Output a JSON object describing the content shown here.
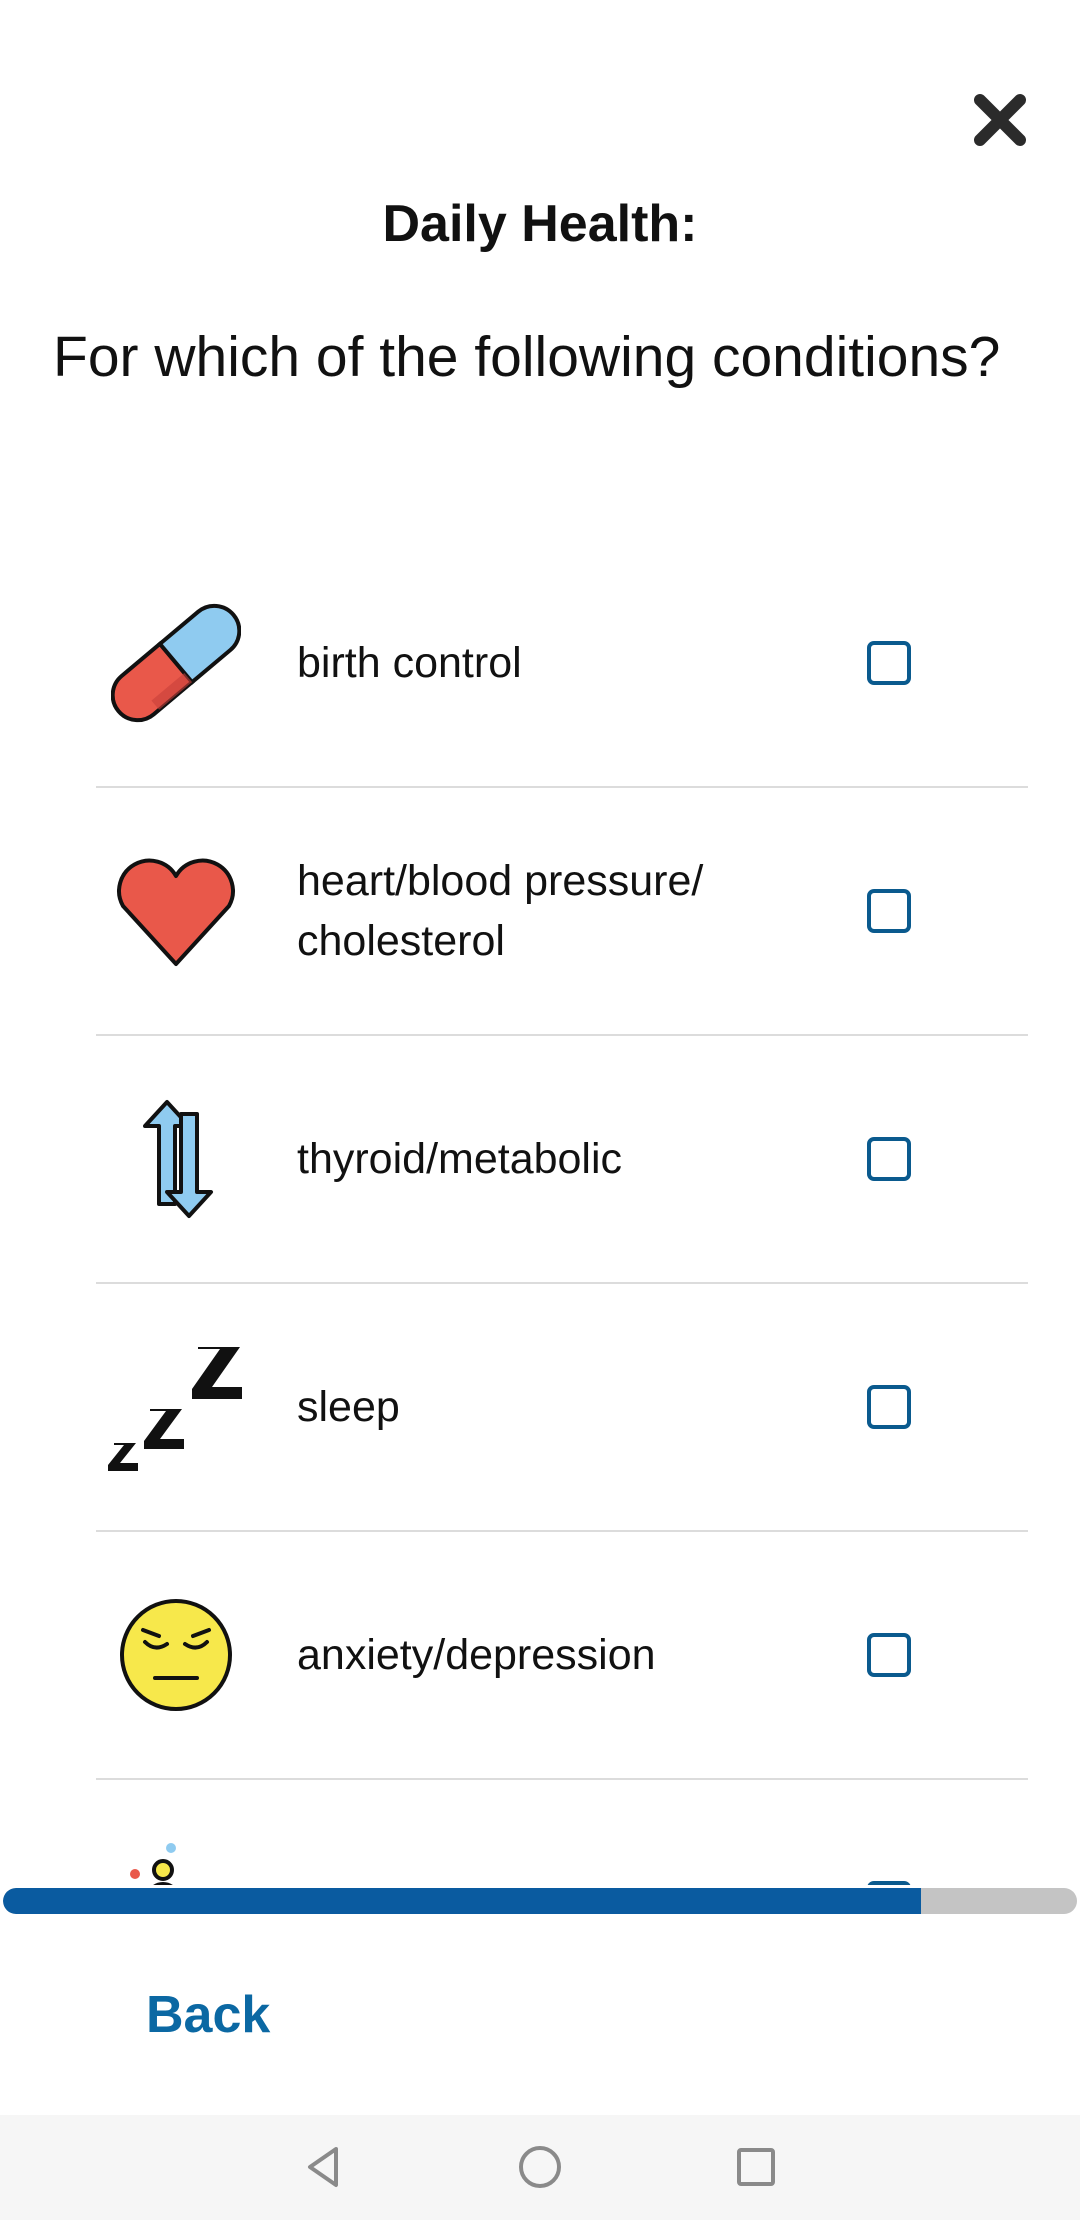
{
  "header": {
    "title": "Daily Health:",
    "close_icon": "close-x-icon"
  },
  "question": "For which of the following conditions?",
  "conditions": [
    {
      "label": "birth control",
      "icon": "pill-icon",
      "checked": false
    },
    {
      "label": "heart/blood pressure/ cholesterol",
      "icon": "heart-icon",
      "checked": false
    },
    {
      "label": "thyroid/metabolic",
      "icon": "arrows-cycle-icon",
      "checked": false
    },
    {
      "label": "sleep",
      "icon": "zzz-icon",
      "checked": false
    },
    {
      "label": "anxiety/depression",
      "icon": "relieved-face-icon",
      "checked": false
    },
    {
      "label": "",
      "icon": "person-meditating-icon",
      "checked": false
    }
  ],
  "progress": {
    "fraction": 0.855,
    "fill_color": "#0a5ba0",
    "track_color": "#c4c4c4"
  },
  "footer": {
    "back_label": "Back"
  },
  "colors": {
    "accent": "#0b68a3",
    "checkbox_border": "#0a5a8e"
  },
  "system_nav": {
    "back_icon": "triangle-back-icon",
    "home_icon": "circle-home-icon",
    "recents_icon": "square-recents-icon"
  }
}
